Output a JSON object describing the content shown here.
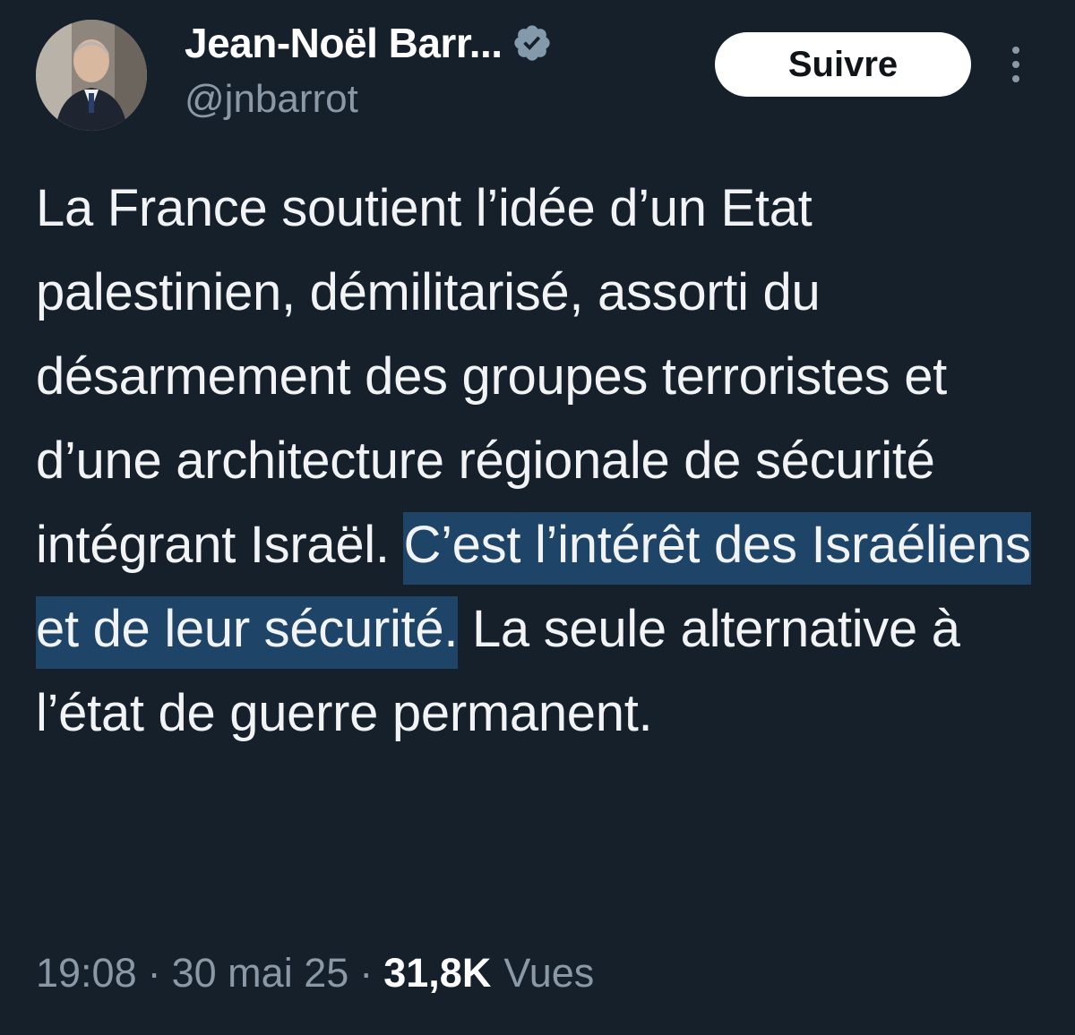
{
  "author": {
    "display_name": "Jean-Noël Barr...",
    "handle": "@jnbarrot",
    "verified_icon": "verified-badge-icon",
    "avatar_icon": "profile-photo"
  },
  "actions": {
    "follow_label": "Suivre",
    "more_icon": "more-vertical-icon"
  },
  "tweet": {
    "text_before": "La France soutient l’idée d’un Etat palestinien, démilitarisé, assorti du désarmement des groupes terroristes et d’une architecture régionale de sécurité intégrant Israël. ",
    "text_highlighted": "C’est l’intérêt des Israéliens et de leur sécurité.",
    "text_after": " La seule alternative à l’état de guerre permanent."
  },
  "meta": {
    "time": "19:08",
    "separator": "·",
    "date": "30 mai 25",
    "views_count": "31,8K",
    "views_label": "Vues"
  },
  "colors": {
    "background": "#15202b",
    "text": "#e7e9ea",
    "muted": "#8b98a5",
    "highlight": "#1e4468",
    "verified_badge": "#829aab"
  }
}
